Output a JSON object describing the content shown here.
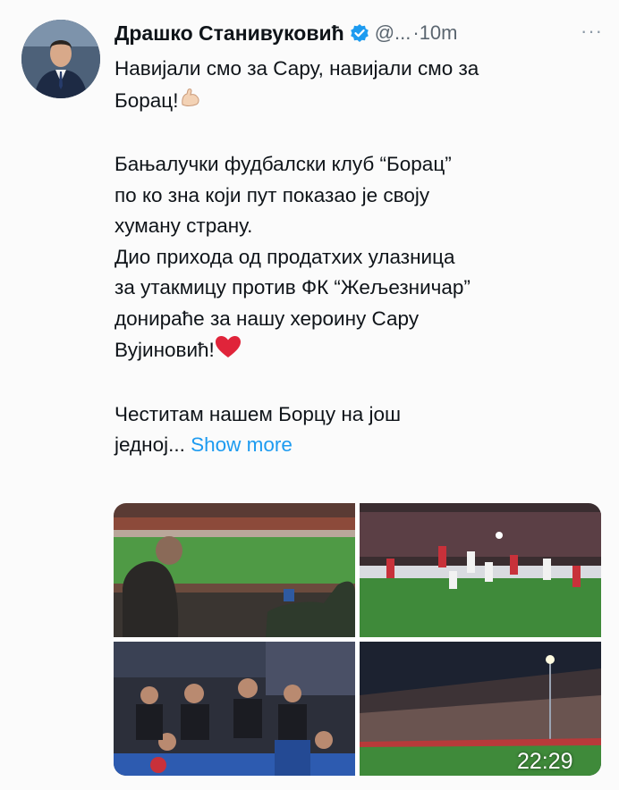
{
  "author": {
    "name": "Драшко Станивуковић",
    "handle": "@...",
    "separator": "·",
    "time_ago": "10m",
    "verified": true,
    "avatar_icon": "profile-photo"
  },
  "tweet": {
    "para1_line1": "Навијали смо за Сару, навијали смо за",
    "para1_line2": "Борац!",
    "para2_line1": "Бањалучки фудбалски клуб “Борац”",
    "para2_line2": "по ко зна који пут показао је своју",
    "para2_line3": "хуману страну.",
    "para2_line4": "Дио прихода од продатхих улазница",
    "para2_line5": "за утакмицу против ФК “Жељезничар”",
    "para2_line6": "донираће за нашу хероину Сару",
    "para2_line7": "Вујиновић!",
    "para3_line1": "Честитам нашем Борцу на још",
    "para3_line2": "једној...",
    "show_more": "Show more"
  },
  "emojis": {
    "flexed_biceps": "flexed-biceps-icon",
    "heart": "red-heart-icon"
  },
  "media": {
    "photos": [
      "stadium-view-from-stands",
      "football-match-action",
      "fans-in-stands",
      "stadium-night-view"
    ]
  },
  "overlay": {
    "clock": "22:29"
  },
  "colors": {
    "accent": "#1d9bf0",
    "text": "#0f1419",
    "muted": "#5b6670",
    "heart": "#e0243a",
    "pitch": "#3f8a3a"
  }
}
